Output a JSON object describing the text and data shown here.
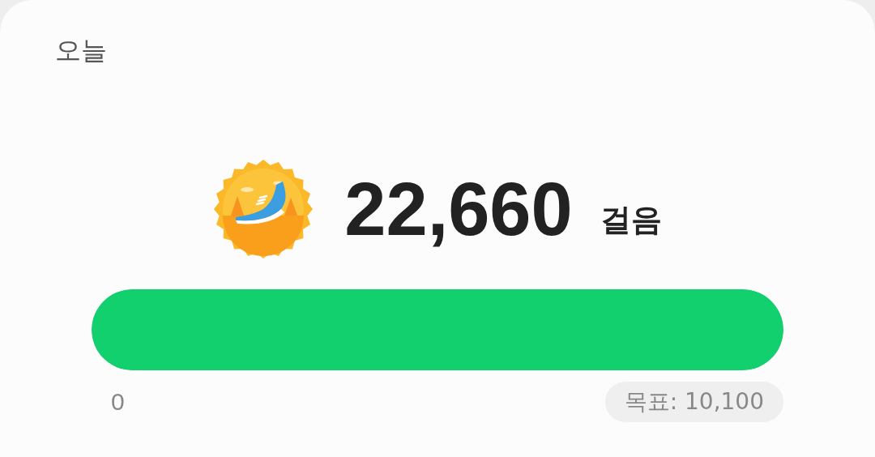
{
  "card": {
    "title": "오늘"
  },
  "steps": {
    "count": "22,660",
    "unit": "걸음"
  },
  "progress": {
    "level": 1,
    "start_label": "0",
    "goal_label": "목표: 10,100"
  }
}
